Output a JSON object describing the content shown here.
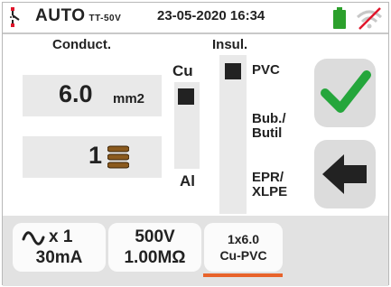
{
  "header": {
    "mode": "AUTO",
    "system": "TT-50V",
    "datetime": "23-05-2020 16:34",
    "battery_color": "#2ca02c",
    "wifi_status": "disabled"
  },
  "conductor": {
    "title": "Conduct.",
    "section_value": "6.0",
    "section_unit": "mm2",
    "count_value": "1"
  },
  "material": {
    "cu_label": "Cu",
    "al_label": "Al"
  },
  "insulation": {
    "title": "Insul.",
    "opt_pvc": "PVC",
    "opt_butil": "Bub./\nButil",
    "opt_epr": "EPR/\nXLPE"
  },
  "actions": {
    "confirm_icon": "checkmark-icon",
    "back_icon": "left-arrow-icon"
  },
  "softkeys": {
    "current_top": "x 1",
    "current_bottom": "30mA",
    "voltage_top": "500V",
    "voltage_bottom": "1.00MΩ",
    "cable_top": "1x6.0",
    "cable_bottom": "Cu-PVC"
  }
}
